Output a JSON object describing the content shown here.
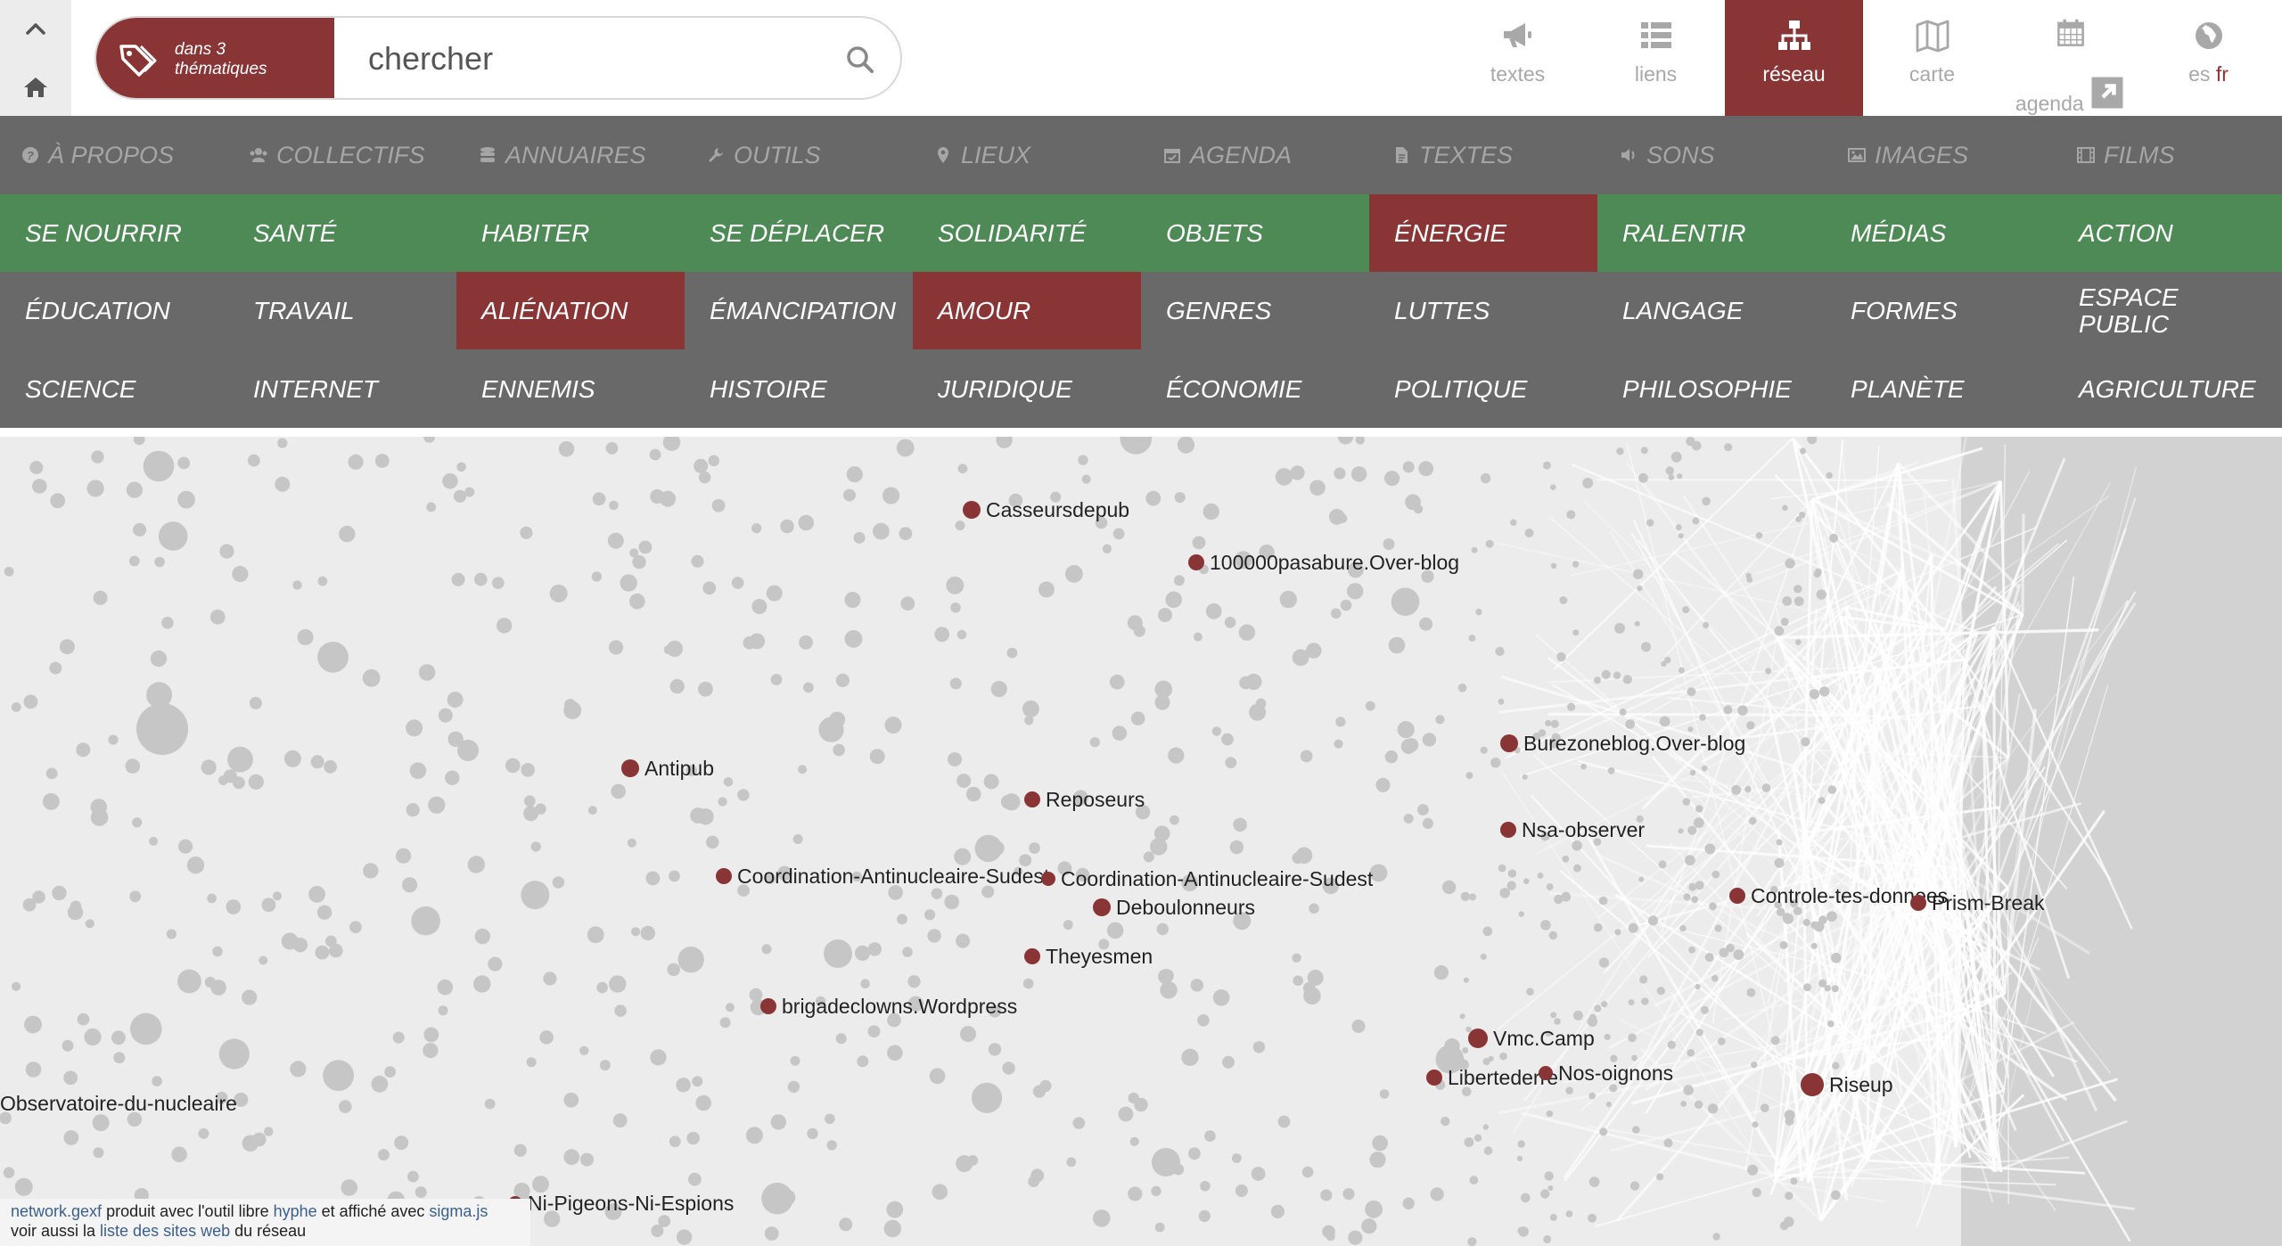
{
  "search": {
    "themes_label": "dans 3 thématiques",
    "placeholder": "chercher"
  },
  "nav": {
    "tabs": [
      {
        "label": "textes",
        "icon": "megaphone-icon"
      },
      {
        "label": "liens",
        "icon": "list-icon"
      },
      {
        "label": "réseau",
        "icon": "sitemap-icon",
        "active": true
      },
      {
        "label": "carte",
        "icon": "map-icon"
      },
      {
        "label": "agenda",
        "icon": "calendar-icon"
      },
      {
        "lang_other": "es",
        "lang_current": "fr",
        "icon": "globe-icon"
      }
    ]
  },
  "sections": [
    "À PROPOS",
    "COLLECTIFS",
    "ANNUAIRES",
    "OUTILS",
    "LIEUX",
    "AGENDA",
    "TEXTES",
    "SONS",
    "IMAGES",
    "FILMS"
  ],
  "categories": {
    "row1": [
      "SE NOURRIR",
      "SANTÉ",
      "HABITER",
      "SE DÉPLACER",
      "SOLIDARITÉ",
      "OBJETS",
      "ÉNERGIE",
      "RALENTIR",
      "MÉDIAS",
      "ACTION"
    ],
    "row2": [
      "ÉDUCATION",
      "TRAVAIL",
      "ALIÉNATION",
      "ÉMANCIPATION",
      "AMOUR",
      "GENRES",
      "LUTTES",
      "LANGAGE",
      "FORMES",
      "ESPACE PUBLIC"
    ],
    "row3": [
      "SCIENCE",
      "INTERNET",
      "ENNEMIS",
      "HISTOIRE",
      "JURIDIQUE",
      "ÉCONOMIE",
      "POLITIQUE",
      "PHILOSOPHIE",
      "PLANÈTE",
      "AGRICULTURE"
    ],
    "selected": [
      "ÉNERGIE",
      "ALIÉNATION",
      "AMOUR"
    ]
  },
  "graph": {
    "highlight_color": "#8a3535",
    "node_color": "#c6c6c6",
    "labels": [
      "Casseursdepub",
      "100000pasabure.Over-blog",
      "Burezoneblog.Over-blog",
      "Antipub",
      "Reposeurs",
      "Nsa-observer",
      "Coordination-Antinucleaire-Sudest",
      "Coordination-Antinucleaire-Sudest",
      "Deboulonneurs",
      "Controle-tes-donnees",
      "Prism-Break",
      "Theyesmen",
      "brigadeclowns.Wordpress",
      "Vmc.Camp",
      "Libertederre",
      "Nos-oignons",
      "Riseup",
      "Observatoire-du-nucleaire",
      "Ni-Pigeons-Ni-Espions"
    ]
  },
  "credits": {
    "file": "network.gexf",
    "t1": " produit avec l'outil libre ",
    "tool": "hyphe",
    "t2": " et affiché avec ",
    "lib": "sigma.js",
    "t3": "voir aussi la ",
    "list": "liste des sites web",
    "t4": " du réseau"
  }
}
